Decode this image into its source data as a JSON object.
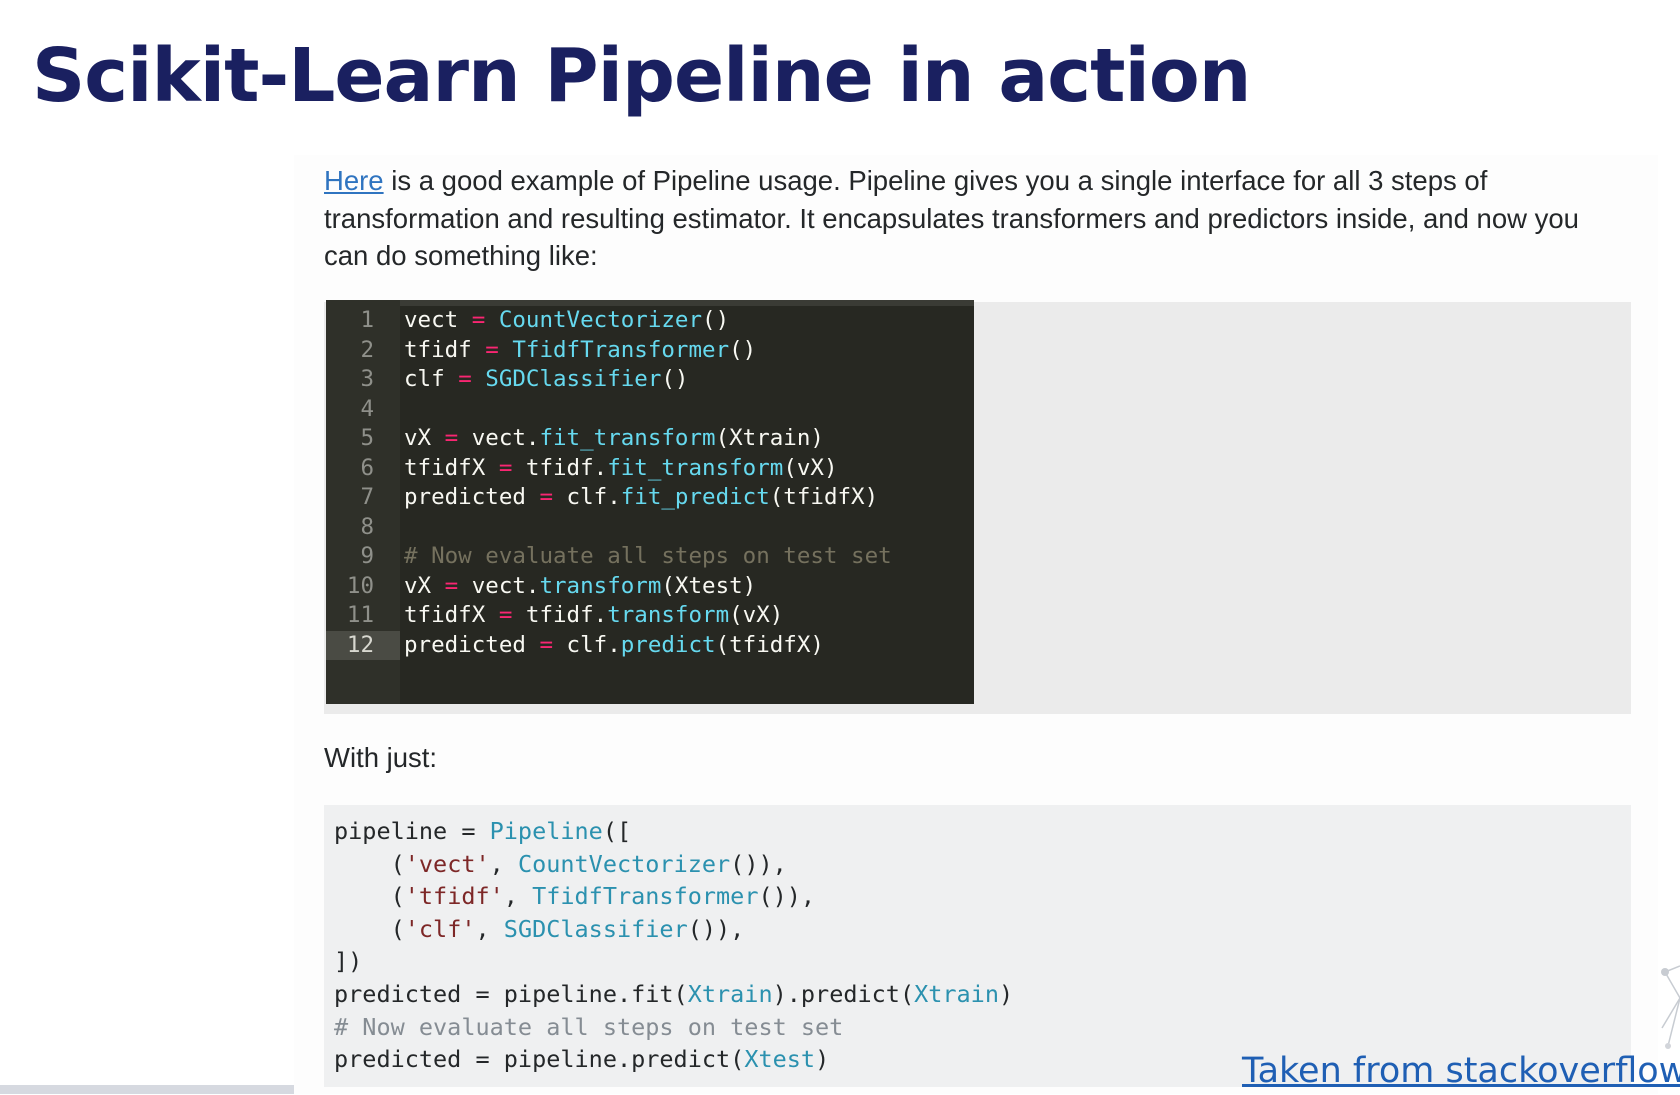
{
  "slide": {
    "title": "Scikit-Learn Pipeline in action"
  },
  "intro": {
    "link_text": "Here",
    "text": " is a good example of Pipeline usage. Pipeline gives you a single interface for all 3 steps of transformation and resulting estimator. It encapsulates transformers and predictors inside, and now you can do something like:"
  },
  "editor_code": {
    "active_line": 12,
    "lines": [
      {
        "n": "1",
        "tokens": [
          [
            "p",
            "vect "
          ],
          [
            "o",
            "="
          ],
          [
            "p",
            " "
          ],
          [
            "f",
            "CountVectorizer"
          ],
          [
            "p",
            "()"
          ]
        ]
      },
      {
        "n": "2",
        "tokens": [
          [
            "p",
            "tfidf "
          ],
          [
            "o",
            "="
          ],
          [
            "p",
            " "
          ],
          [
            "f",
            "TfidfTransformer"
          ],
          [
            "p",
            "()"
          ]
        ]
      },
      {
        "n": "3",
        "tokens": [
          [
            "p",
            "clf "
          ],
          [
            "o",
            "="
          ],
          [
            "p",
            " "
          ],
          [
            "f",
            "SGDClassifier"
          ],
          [
            "p",
            "()"
          ]
        ]
      },
      {
        "n": "4",
        "tokens": []
      },
      {
        "n": "5",
        "tokens": [
          [
            "p",
            "vX "
          ],
          [
            "o",
            "="
          ],
          [
            "p",
            " vect."
          ],
          [
            "f",
            "fit_transform"
          ],
          [
            "p",
            "(Xtrain)"
          ]
        ]
      },
      {
        "n": "6",
        "tokens": [
          [
            "p",
            "tfidfX "
          ],
          [
            "o",
            "="
          ],
          [
            "p",
            " tfidf."
          ],
          [
            "f",
            "fit_transform"
          ],
          [
            "p",
            "(vX)"
          ]
        ]
      },
      {
        "n": "7",
        "tokens": [
          [
            "p",
            "predicted "
          ],
          [
            "o",
            "="
          ],
          [
            "p",
            " clf."
          ],
          [
            "f",
            "fit_predict"
          ],
          [
            "p",
            "(tfidfX)"
          ]
        ]
      },
      {
        "n": "8",
        "tokens": []
      },
      {
        "n": "9",
        "tokens": [
          [
            "c",
            "# Now evaluate all steps on test set"
          ]
        ]
      },
      {
        "n": "10",
        "tokens": [
          [
            "p",
            "vX "
          ],
          [
            "o",
            "="
          ],
          [
            "p",
            " vect."
          ],
          [
            "f",
            "transform"
          ],
          [
            "p",
            "(Xtest)"
          ]
        ]
      },
      {
        "n": "11",
        "tokens": [
          [
            "p",
            "tfidfX "
          ],
          [
            "o",
            "="
          ],
          [
            "p",
            " tfidf."
          ],
          [
            "f",
            "transform"
          ],
          [
            "p",
            "(vX)"
          ]
        ]
      },
      {
        "n": "12",
        "tokens": [
          [
            "p",
            "predicted "
          ],
          [
            "o",
            "="
          ],
          [
            "p",
            " clf."
          ],
          [
            "f",
            "predict"
          ],
          [
            "p",
            "(tfidfX)"
          ]
        ]
      }
    ]
  },
  "with_just": "With just:",
  "pipeline_code": {
    "lines": [
      [
        [
          "p",
          "pipeline = "
        ],
        [
          "f",
          "Pipeline"
        ],
        [
          "p",
          "(["
        ]
      ],
      [
        [
          "p",
          "    ("
        ],
        [
          "s",
          "'vect'"
        ],
        [
          "p",
          ", "
        ],
        [
          "f",
          "CountVectorizer"
        ],
        [
          "p",
          "()),"
        ]
      ],
      [
        [
          "p",
          "    ("
        ],
        [
          "s",
          "'tfidf'"
        ],
        [
          "p",
          ", "
        ],
        [
          "f",
          "TfidfTransformer"
        ],
        [
          "p",
          "()),"
        ]
      ],
      [
        [
          "p",
          "    ("
        ],
        [
          "s",
          "'clf'"
        ],
        [
          "p",
          ", "
        ],
        [
          "f",
          "SGDClassifier"
        ],
        [
          "p",
          "()),"
        ]
      ],
      [
        [
          "p",
          "])"
        ]
      ],
      [
        [
          "p",
          "predicted = pipeline.fit("
        ],
        [
          "f",
          "Xtrain"
        ],
        [
          "p",
          ").predict("
        ],
        [
          "f",
          "Xtrain"
        ],
        [
          "p",
          ")"
        ]
      ],
      [
        [
          "c",
          "# Now evaluate all steps on test set"
        ]
      ],
      [
        [
          "p",
          "predicted = pipeline.predict("
        ],
        [
          "f",
          "Xtest"
        ],
        [
          "p",
          ")"
        ]
      ]
    ]
  },
  "footer": {
    "source_link": "Taken from stackoverflow"
  },
  "colors": {
    "title": "#1a2060",
    "link": "#2f74c0",
    "editor_bg": "#272822",
    "editor_function": "#66d9ef",
    "editor_operator": "#f92672",
    "editor_comment": "#75715e",
    "code_block_bg": "#eff0f1",
    "code_block_type": "#2b91af",
    "code_block_string": "#7d2727"
  }
}
